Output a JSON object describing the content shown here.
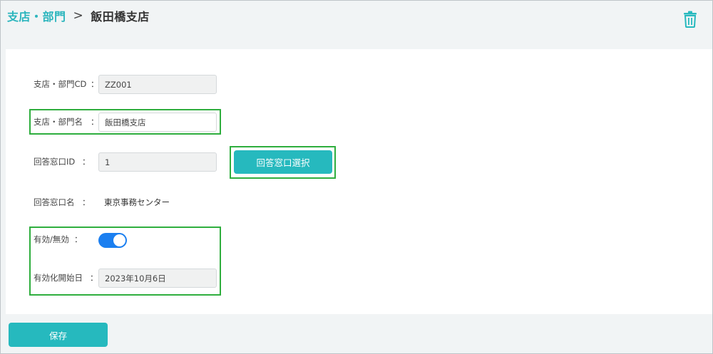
{
  "breadcrumb": {
    "parent": "支店・部門",
    "separator": ">",
    "current": "飯田橋支店"
  },
  "icons": {
    "delete": "trash-icon"
  },
  "form": {
    "code": {
      "label": "支店・部門CD",
      "colon": "：",
      "value": "ZZ001"
    },
    "name": {
      "label": "支店・部門名",
      "colon": "：",
      "value": "飯田橋支店"
    },
    "window_id": {
      "label": "回答窓口ID",
      "colon": "：",
      "value": "1"
    },
    "window_select_button": "回答窓口選択",
    "window_name": {
      "label": "回答窓口名",
      "colon": "：",
      "value": "東京事務センター"
    },
    "enabled": {
      "label": "有効/無効",
      "colon": "：",
      "value": true
    },
    "start_date": {
      "label": "有効化開始日",
      "colon": "：",
      "value": "2023年10月6日"
    }
  },
  "footer": {
    "save_label": "保存"
  },
  "colors": {
    "accent": "#26b9be",
    "breadcrumb": "#2bb5bd",
    "toggle_on": "#1b7ff0",
    "highlight": "#2fae3e"
  }
}
